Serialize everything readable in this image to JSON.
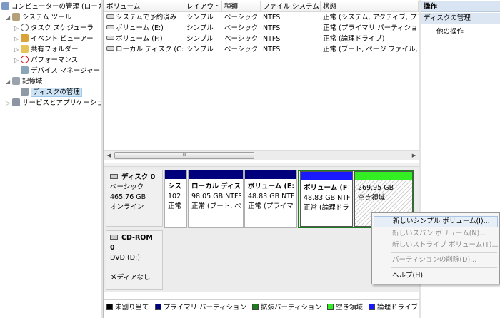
{
  "tree": {
    "root": "コンピューターの管理 (ローカ",
    "system_tools": "システム ツール",
    "task_scheduler": "タスク スケジューラ",
    "event_viewer": "イベント ビューアー",
    "shared_folders": "共有フォルダー",
    "performance": "パフォーマンス",
    "device_manager": "デバイス マネージャー",
    "storage": "記憶域",
    "disk_management": "ディスクの管理",
    "services_apps": "サービスとアプリケーション"
  },
  "volume_table": {
    "headers": [
      "ボリューム",
      "レイアウト",
      "種類",
      "ファイル システム",
      "状態"
    ],
    "rows": [
      [
        "システムで予約済み",
        "シンプル",
        "ベーシック",
        "NTFS",
        "正常 (システム, アクティブ, プラ"
      ],
      [
        "ボリューム (E:)",
        "シンプル",
        "ベーシック",
        "NTFS",
        "正常 (プライマリ パーティショ"
      ],
      [
        "ボリューム (F:)",
        "シンプル",
        "ベーシック",
        "NTFS",
        "正常 (論理ドライブ)"
      ],
      [
        "ローカル ディスク (C:)",
        "シンプル",
        "ベーシック",
        "NTFS",
        "正常 (ブート, ページ ファイル,"
      ]
    ],
    "scroll_grip": "III"
  },
  "disk0": {
    "name": "ディスク 0",
    "type": "ベーシック",
    "size": "465.76 GB",
    "status": "オンライン",
    "partitions": [
      {
        "name": "シス",
        "size": "102 I",
        "status": "正常"
      },
      {
        "name": "ローカル ディスク",
        "size": "98.05 GB NTFS",
        "status": "正常 (ブート, ペ"
      },
      {
        "name": "ボリューム (E:",
        "size": "48.83 GB NTFS",
        "status": "正常 (プライマ"
      },
      {
        "name": "ボリューム (F",
        "size": "48.83 GB NTF",
        "status": "正常 (論理ドラ"
      },
      {
        "name": "",
        "size": "269.95 GB",
        "status": "空き領域"
      }
    ]
  },
  "cdrom0": {
    "name": "CD-ROM 0",
    "drive": "DVD (D:)",
    "media": "メディアなし"
  },
  "legend": [
    {
      "label": "未割り当て",
      "color": "#000000"
    },
    {
      "label": "プライマリ パーティション",
      "color": "#00007d"
    },
    {
      "label": "拡張パーティション",
      "color": "#1c7d1c"
    },
    {
      "label": "空き領域",
      "color": "#33ee22"
    },
    {
      "label": "論理ドライブ",
      "color": "#1a1aff"
    }
  ],
  "actions": {
    "header": "操作",
    "section": "ディスクの管理",
    "other": "他の操作"
  },
  "context_menu": {
    "new_simple": "新しいシンプル ボリューム(I)...",
    "new_spanned": "新しいスパン ボリューム(N)...",
    "new_striped": "新しいストライプ ボリューム(T)...",
    "delete_partition": "パーティションの削除(D)...",
    "help": "ヘルプ(H)"
  },
  "colors": {
    "primary_bar": "#00007d",
    "logical_bar": "#1a1aff",
    "extended_border": "#1c7d1c",
    "free_bar": "#33ee22"
  }
}
